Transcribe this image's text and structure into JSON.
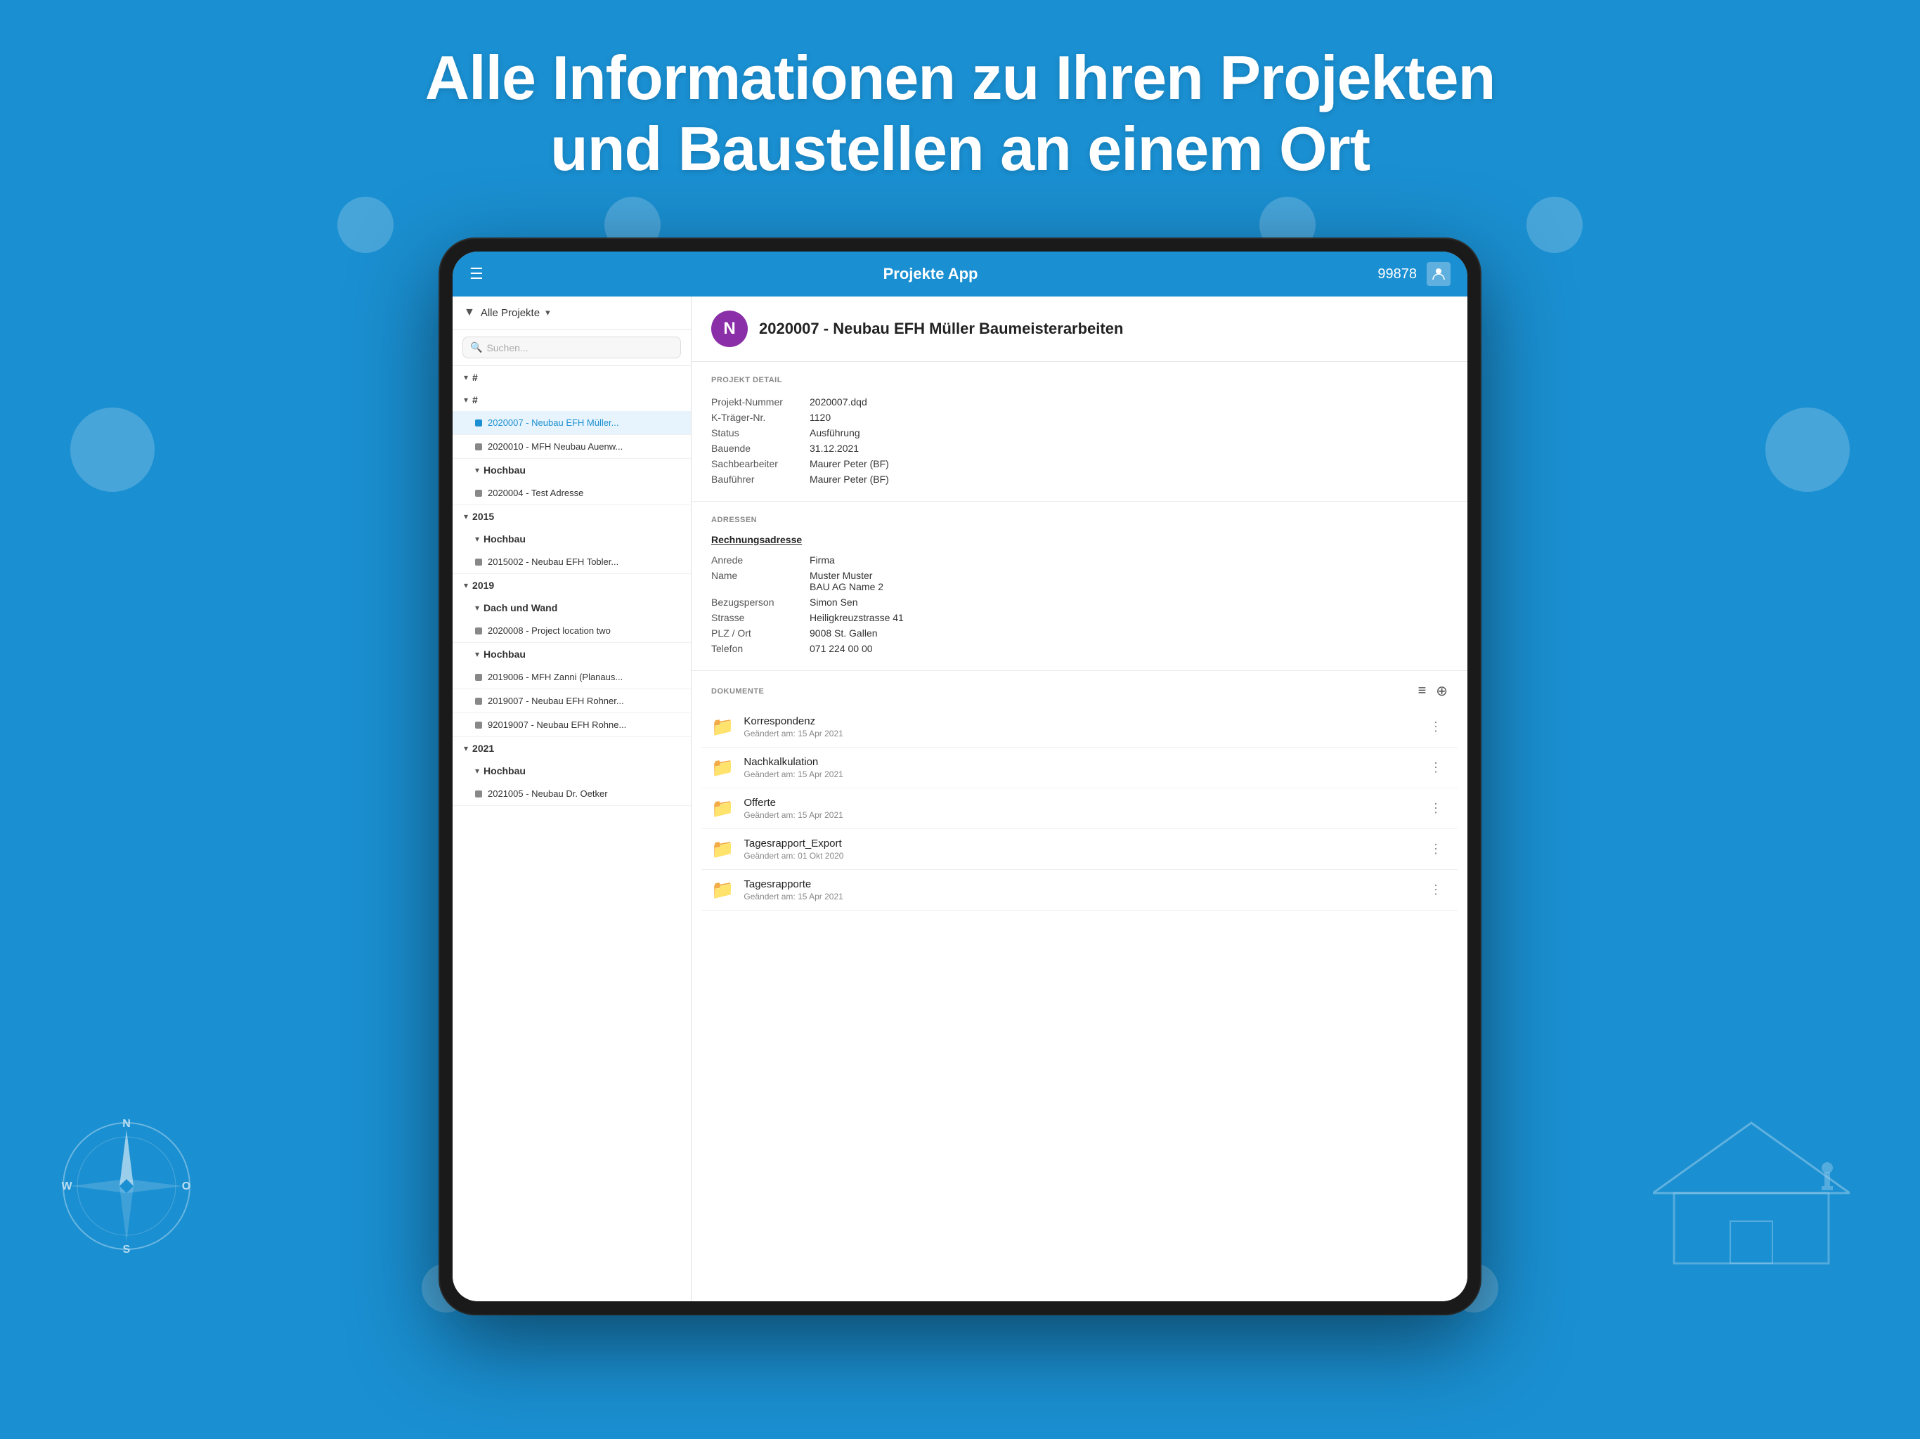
{
  "background_color": "#1a8fd1",
  "hero": {
    "line1": "Alle Informationen zu Ihren Projekten",
    "line2": "und Baustellen an einem Ort"
  },
  "app": {
    "topbar": {
      "menu_icon": "☰",
      "title": "Projekte App",
      "user_id": "99878",
      "avatar_icon": "person"
    },
    "sidebar": {
      "filter_label": "Alle Projekte",
      "filter_chevron": "▾",
      "search_placeholder": "Suchen...",
      "groups": [
        {
          "id": "g1",
          "label": "#",
          "chevron": "▾",
          "items": []
        },
        {
          "id": "g2",
          "label": "#",
          "chevron": "▾",
          "items": [
            {
              "id": "i1",
              "label": "2020007 - Neubau EFH Müller...",
              "active": true
            },
            {
              "id": "i2",
              "label": "2020010 - MFH Neubau Auenw..."
            },
            {
              "id": "i3",
              "label": "",
              "is_subgroup": true,
              "sublabel": "Hochbau"
            },
            {
              "id": "i4",
              "label": "2020004 - Test Adresse"
            }
          ]
        },
        {
          "id": "g3",
          "label": "2015",
          "chevron": "▾",
          "items": [
            {
              "id": "i5",
              "label": "",
              "is_subgroup": true,
              "sublabel": "Hochbau"
            },
            {
              "id": "i6",
              "label": "2015002 - Neubau EFH Tobler..."
            }
          ]
        },
        {
          "id": "g4",
          "label": "2019",
          "chevron": "▾",
          "items": [
            {
              "id": "i7",
              "label": "",
              "is_subgroup": true,
              "sublabel": "Dach und Wand"
            },
            {
              "id": "i8",
              "label": "2020008 - Project location two"
            },
            {
              "id": "i9",
              "label": "",
              "is_subgroup": true,
              "sublabel": "Hochbau"
            },
            {
              "id": "i10",
              "label": "2019006 - MFH Zanni (Planaus..."
            },
            {
              "id": "i11",
              "label": "2019007 - Neubau EFH Rohner..."
            },
            {
              "id": "i12",
              "label": "92019007 - Neubau EFH Rohne..."
            }
          ]
        },
        {
          "id": "g5",
          "label": "2021",
          "chevron": "▾",
          "items": [
            {
              "id": "i13",
              "label": "",
              "is_subgroup": true,
              "sublabel": "Hochbau"
            },
            {
              "id": "i14",
              "label": "2021005 - Neubau Dr. Oetker"
            }
          ]
        }
      ]
    },
    "detail": {
      "project_avatar_letter": "N",
      "project_title": "2020007 - Neubau EFH Müller Baumeisterarbeiten",
      "sections": {
        "projekt_detail": {
          "label": "PROJEKT DETAIL",
          "rows": [
            {
              "key": "Projekt-Nummer",
              "value": "2020007.dqd",
              "link": true
            },
            {
              "key": "K-Träger-Nr.",
              "value": "1120"
            },
            {
              "key": "Status",
              "value": "Ausführung",
              "link": true
            },
            {
              "key": "Bauende",
              "value": "31.12.2021"
            },
            {
              "key": "Sachbearbeiter",
              "value": "Maurer Peter (BF)",
              "link": true
            },
            {
              "key": "Bauführer",
              "value": "Maurer Peter (BF)",
              "link": true
            }
          ]
        },
        "adressen": {
          "label": "ADRESSEN",
          "rechnungsadresse_title": "Rechnungsadresse",
          "rows": [
            {
              "key": "Anrede",
              "value": "Firma",
              "link": true
            },
            {
              "key": "Name",
              "value": "Muster Muster\nBAU AG Name 2",
              "link": true
            },
            {
              "key": "Bezugsperson",
              "value": "Simon Sen",
              "link": true
            },
            {
              "key": "Strasse",
              "value": "Heiligkreuzstrasse 41",
              "link": true
            },
            {
              "key": "PLZ / Ort",
              "value": "9008 St. Gallen",
              "link": true
            },
            {
              "key": "Telefon",
              "value": "071 224 00 00",
              "link": true
            }
          ]
        },
        "dokumente": {
          "label": "DOKUMENTE",
          "items": [
            {
              "name": "Korrespondenz",
              "date": "Geändert am: 15 Apr 2021"
            },
            {
              "name": "Nachkalkulation",
              "date": "Geändert am: 15 Apr 2021"
            },
            {
              "name": "Offerte",
              "date": "Geändert am: 15 Apr 2021"
            },
            {
              "name": "Tagesrapport_Export",
              "date": "Geändert am: 01 Okt 2020"
            },
            {
              "name": "Tagesrapporte",
              "date": "Geändert am: 15 Apr 2021"
            }
          ]
        }
      }
    }
  }
}
